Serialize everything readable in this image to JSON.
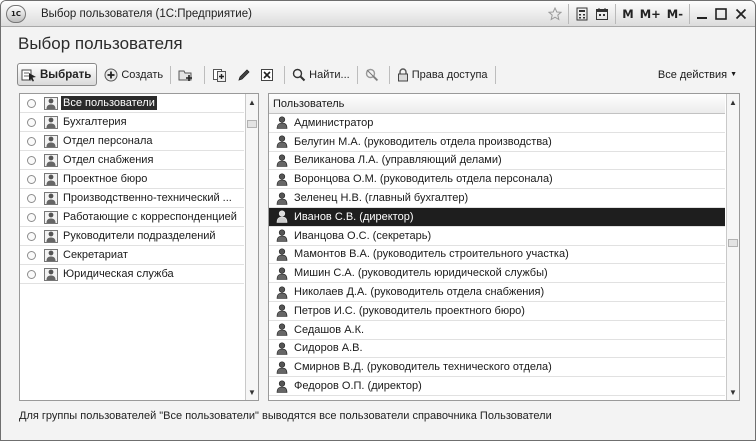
{
  "window": {
    "logo": "1С",
    "title": "Выбор пользователя  (1С:Предприятие)",
    "controls": {
      "m": "M",
      "m_plus": "M+",
      "m_minus": "M-"
    }
  },
  "form": {
    "title": "Выбор пользователя"
  },
  "toolbar": {
    "select": "Выбрать",
    "create": "Создать",
    "find": "Найти...",
    "access_rights": "Права доступа",
    "all_actions": "Все действия"
  },
  "groups": [
    {
      "label": "Все пользователи",
      "selected": true
    },
    {
      "label": "Бухгалтерия"
    },
    {
      "label": "Отдел персонала"
    },
    {
      "label": "Отдел снабжения"
    },
    {
      "label": "Проектное бюро"
    },
    {
      "label": "Производственно-технический ..."
    },
    {
      "label": "Работающие с корреспонденцией"
    },
    {
      "label": "Руководители подразделений"
    },
    {
      "label": "Секретариат"
    },
    {
      "label": "Юридическая служба"
    }
  ],
  "users": {
    "column": "Пользователь",
    "rows": [
      "Администратор",
      "Белугин М.А. (руководитель отдела производства)",
      "Великанова Л.А. (управляющий делами)",
      "Воронцова О.М. (руководитель отдела персонала)",
      "Зеленец Н.В. (главный бухгалтер)",
      "Иванов С.В. (директор)",
      "Иванцова О.С. (секретарь)",
      "Мамонтов В.А. (руководитель строительного участка)",
      "Мишин С.А. (руководитель юридической службы)",
      "Николаев Д.А. (руководитель отдела снабжения)",
      "Петров И.С. (руководитель проектного бюро)",
      "Седашов А.К.",
      "Сидоров А.В.",
      "Смирнов В.Д. (руководитель технического отдела)",
      "Федоров О.П. (директор)"
    ],
    "selected_index": 5
  },
  "status": "Для группы пользователей \"Все пользователи\" выводятся все пользователи справочника Пользователи"
}
